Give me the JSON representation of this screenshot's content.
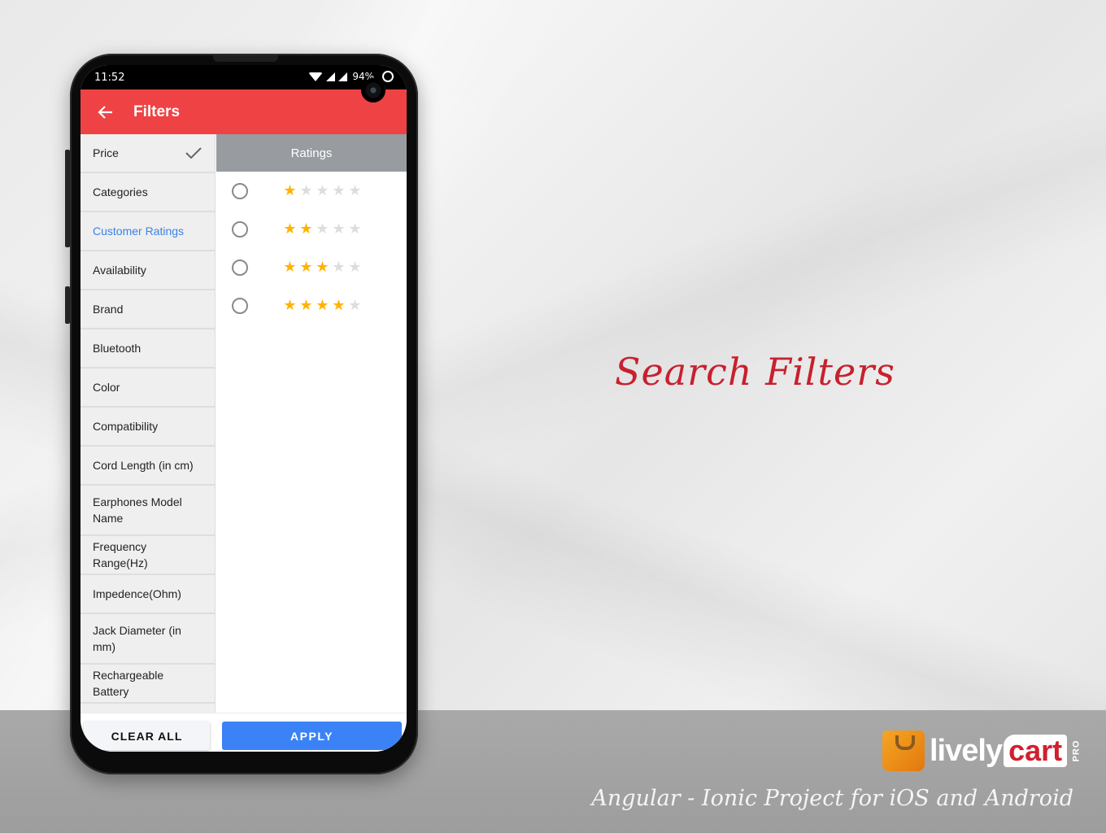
{
  "headline": "Search Filters",
  "tagline": "Angular - Ionic Project for iOS and Android",
  "logo": {
    "part1": "lively",
    "part2": "cart",
    "badge": "PRO"
  },
  "phone": {
    "status": {
      "time": "11:52",
      "battery": "94%"
    },
    "appbar": {
      "title": "Filters"
    },
    "filters": {
      "categories": [
        {
          "label": "Price",
          "checked": true,
          "active": false
        },
        {
          "label": "Categories",
          "checked": false,
          "active": false
        },
        {
          "label": "Customer Ratings",
          "checked": false,
          "active": true
        },
        {
          "label": "Availability",
          "checked": false,
          "active": false
        },
        {
          "label": "Brand",
          "checked": false,
          "active": false
        },
        {
          "label": "Bluetooth",
          "checked": false,
          "active": false
        },
        {
          "label": "Color",
          "checked": false,
          "active": false
        },
        {
          "label": "Compatibility",
          "checked": false,
          "active": false
        },
        {
          "label": "Cord Length (in cm)",
          "checked": false,
          "active": false
        },
        {
          "label": "Earphones Model Name",
          "checked": false,
          "active": false
        },
        {
          "label": "Frequency Range(Hz)",
          "checked": false,
          "active": false
        },
        {
          "label": "Impedence(Ohm)",
          "checked": false,
          "active": false
        },
        {
          "label": "Jack Diameter (in mm)",
          "checked": false,
          "active": false
        },
        {
          "label": "Rechargeable Battery",
          "checked": false,
          "active": false
        }
      ],
      "panel_title": "Ratings",
      "rating_options": [
        {
          "stars": 1,
          "max": 5,
          "selected": false
        },
        {
          "stars": 2,
          "max": 5,
          "selected": false
        },
        {
          "stars": 3,
          "max": 5,
          "selected": false
        },
        {
          "stars": 4,
          "max": 5,
          "selected": false
        }
      ]
    },
    "buttons": {
      "clear": "CLEAR ALL",
      "apply": "APPLY"
    }
  },
  "colors": {
    "appbar": "#ef4244",
    "active_item": "#3b82e6",
    "apply": "#3b82f6",
    "star_on": "#ffb200",
    "headline": "#c8202e"
  }
}
